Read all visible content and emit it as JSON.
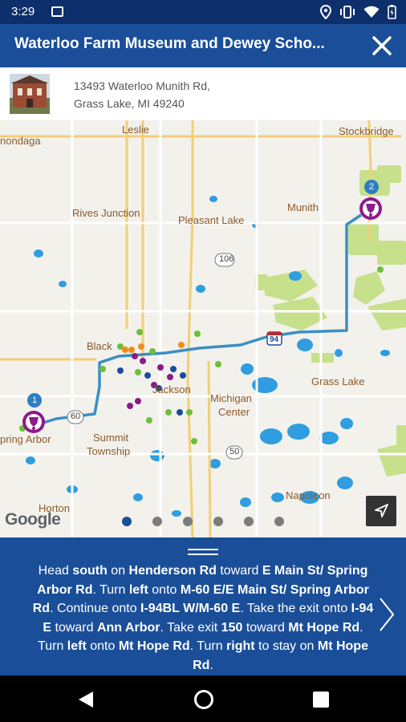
{
  "status": {
    "time": "3:29",
    "icons": [
      "image-icon",
      "location-icon",
      "vibrate-icon",
      "wifi-icon",
      "battery-icon"
    ]
  },
  "header": {
    "title": "Waterloo Farm Museum and Dewey Scho...",
    "close_icon": "close-icon"
  },
  "place": {
    "address_line1": "13493 Waterloo Munith Rd,",
    "address_line2": "Grass Lake, MI 49240"
  },
  "map": {
    "labels": {
      "leslie": "Leslie",
      "stockbridge": "Stockbridge",
      "onandaga": "nondaga",
      "rives_junction": "Rives Junction",
      "pleasant_lake": "Pleasant Lake",
      "munith": "Munith",
      "blackman": "Black",
      "jackson": "Jackson",
      "grass_lake": "Grass Lake",
      "michigan_center_1": "Michigan",
      "michigan_center_2": "Center",
      "spring_arbor": "pring Arbor",
      "summit_1": "Summit",
      "summit_2": "Township",
      "napoleon": "Napoleon",
      "horton": "Horton"
    },
    "shields": {
      "m106": "106",
      "i94": "94",
      "m60": "60",
      "m50": "50"
    },
    "markers": [
      {
        "number": "1"
      },
      {
        "number": "2"
      }
    ],
    "google": "Google",
    "page_count": 6,
    "active_page": 0
  },
  "directions": {
    "parts": [
      {
        "t": "Head ",
        "b": false
      },
      {
        "t": "south",
        "b": true
      },
      {
        "t": " on ",
        "b": false
      },
      {
        "t": "Henderson Rd",
        "b": true
      },
      {
        "t": " toward ",
        "b": false
      },
      {
        "t": "E Main St/ Spring Arbor Rd",
        "b": true
      },
      {
        "t": ". Turn ",
        "b": false
      },
      {
        "t": "left",
        "b": true
      },
      {
        "t": " onto ",
        "b": false
      },
      {
        "t": "M-60 E/E Main St/ Spring Arbor Rd",
        "b": true
      },
      {
        "t": ". Continue onto ",
        "b": false
      },
      {
        "t": "I-94BL W/M-60 E",
        "b": true
      },
      {
        "t": ". Take the exit onto ",
        "b": false
      },
      {
        "t": "I-94 E",
        "b": true
      },
      {
        "t": " toward ",
        "b": false
      },
      {
        "t": "Ann Arbor",
        "b": true
      },
      {
        "t": ". Take exit ",
        "b": false
      },
      {
        "t": "150",
        "b": true
      },
      {
        "t": " toward ",
        "b": false
      },
      {
        "t": "Mt Hope Rd",
        "b": true
      },
      {
        "t": ". Turn ",
        "b": false
      },
      {
        "t": "left",
        "b": true
      },
      {
        "t": " onto ",
        "b": false
      },
      {
        "t": "Mt Hope Rd",
        "b": true
      },
      {
        "t": ". Turn ",
        "b": false
      },
      {
        "t": "right",
        "b": true
      },
      {
        "t": " to stay on ",
        "b": false
      },
      {
        "t": "Mt Hope Rd",
        "b": true
      },
      {
        "t": ".",
        "b": false
      }
    ]
  },
  "colors": {
    "status_bar": "#0d2f6b",
    "app_bar": "#1a4e98",
    "route": "#3a8fc4",
    "marker": "#8c1a8c"
  }
}
